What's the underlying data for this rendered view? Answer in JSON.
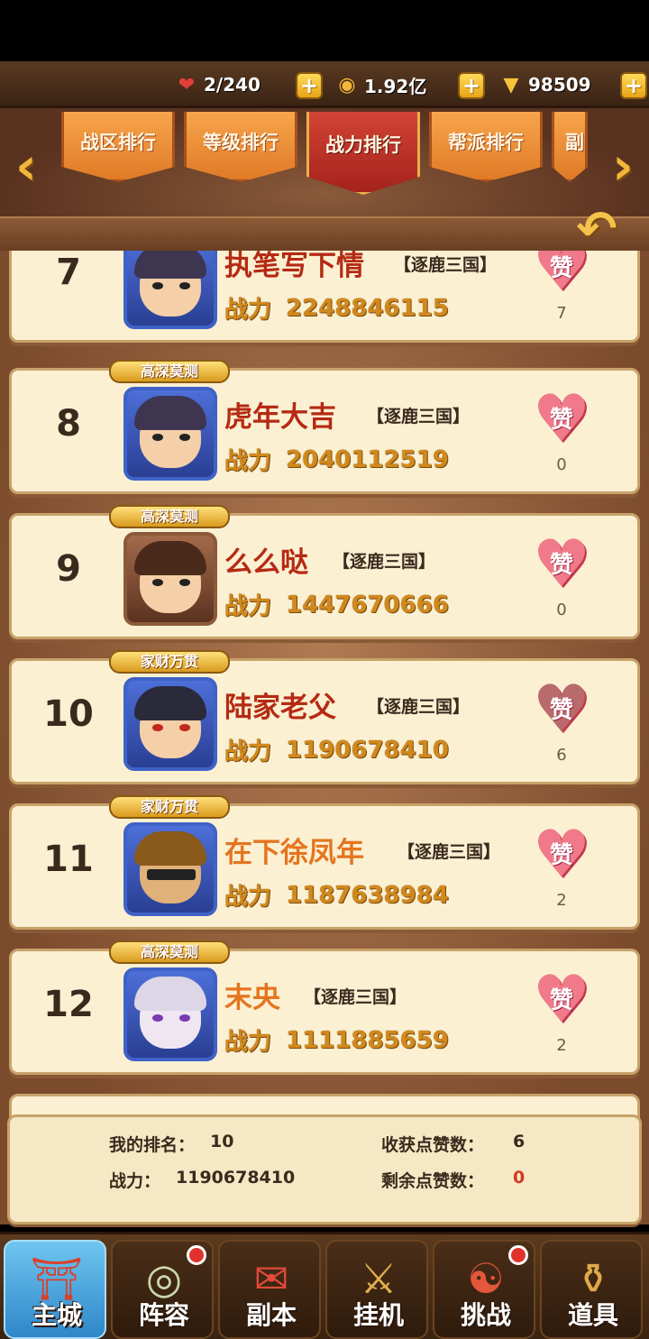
{
  "resources": {
    "stamina": "2/240",
    "coins": "1.92亿",
    "ingots": "98509"
  },
  "tabs": [
    {
      "label": "战区排行",
      "active": false
    },
    {
      "label": "等级排行",
      "active": false
    },
    {
      "label": "战力排行",
      "active": true
    },
    {
      "label": "帮派排行",
      "active": false
    },
    {
      "label": "副",
      "active": false
    }
  ],
  "power_label": "战力",
  "like_label": "赞",
  "entries": [
    {
      "rank": "7",
      "name": "执笔写下情",
      "server": "【逐鹿三国】",
      "power": "2248846115",
      "likes": "7",
      "badge": "",
      "name_color": "red"
    },
    {
      "rank": "8",
      "name": "虎年大吉",
      "server": "【逐鹿三国】",
      "power": "2040112519",
      "likes": "0",
      "badge": "高深莫测",
      "name_color": "red"
    },
    {
      "rank": "9",
      "name": "么么哒",
      "server": "【逐鹿三国】",
      "power": "1447670666",
      "likes": "0",
      "badge": "高深莫测",
      "name_color": "red"
    },
    {
      "rank": "10",
      "name": "陆家老父",
      "server": "【逐鹿三国】",
      "power": "1190678410",
      "likes": "6",
      "badge": "家财万贯",
      "name_color": "red"
    },
    {
      "rank": "11",
      "name": "在下徐凤年",
      "server": "【逐鹿三国】",
      "power": "1187638984",
      "likes": "2",
      "badge": "家财万贯",
      "name_color": "orange"
    },
    {
      "rank": "12",
      "name": "末央",
      "server": "【逐鹿三国】",
      "power": "1111885659",
      "likes": "2",
      "badge": "高深莫测",
      "name_color": "orange"
    }
  ],
  "summary": {
    "my_rank_label": "我的排名：",
    "my_rank": "10",
    "power_label": "战力：",
    "power": "1190678410",
    "received_likes_label": "收获点赞数：",
    "received_likes": "6",
    "remaining_likes_label": "剩余点赞数：",
    "remaining_likes": "0"
  },
  "bottom_nav": [
    {
      "label": "主城",
      "icon": "palace-icon",
      "active": true,
      "dot": false
    },
    {
      "label": "阵容",
      "icon": "formation-icon",
      "active": false,
      "dot": true
    },
    {
      "label": "副本",
      "icon": "scroll-icon",
      "active": false,
      "dot": false
    },
    {
      "label": "挂机",
      "icon": "idle-icon",
      "active": false,
      "dot": false
    },
    {
      "label": "挑战",
      "icon": "challenge-icon",
      "active": false,
      "dot": true
    },
    {
      "label": "道具",
      "icon": "bag-icon",
      "active": false,
      "dot": false
    }
  ]
}
